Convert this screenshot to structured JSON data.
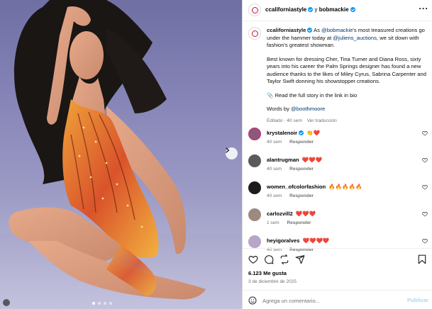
{
  "post": {
    "header_owner": "ccaliforniastyle",
    "header_joiner": "y",
    "header_collaborator": "bobmackie"
  },
  "caption": {
    "username": "ccaliforniastyle",
    "lead": "As ",
    "mention_1": "@bobmackie",
    "part_2": "'s most treasured creations go under the hammer today at ",
    "mention_2": "@juliens_auctions",
    "part_3": ", we sit down with fashion's greatest showman.",
    "paragraph_2": "Best known for dressing Cher, Tina Turner and Diana Ross, sixty years into his career the Palm Springs designer has found a new audience thanks to the likes of Miley Cyrus, Sabrina Carpenter and Taylor Swift donning his showstopper creations.",
    "paragraph_3": "📎 Read the full story in the link in bio",
    "words_by": "Words by ",
    "words_by_mention": "@boothmoore",
    "edited": "Editado · 40 sem",
    "see_translation": "Ver traducción"
  },
  "comments": [
    {
      "user": "krystalenoir",
      "verified": true,
      "text": "👏❤️",
      "time": "40 sem",
      "reply": "Responder",
      "avatar_color": "#8a5a7a"
    },
    {
      "user": "alantrugman",
      "verified": false,
      "text": "❤️❤️❤️",
      "time": "40 sem",
      "reply": "Responder",
      "avatar_color": "#5a5a5a"
    },
    {
      "user": "women_ofcolorfashion",
      "verified": false,
      "text": "🔥🔥🔥🔥🔥",
      "time": "40 sem",
      "reply": "Responder",
      "avatar_color": "#1c1c1c"
    },
    {
      "user": "carlozvill2",
      "verified": false,
      "text": "❤️❤️❤️",
      "time": "1 sem",
      "reply": "Responder",
      "avatar_color": "#9c8a80"
    },
    {
      "user": "heyigoralves",
      "verified": false,
      "text": "❤️❤️❤️❤️",
      "time": "40 sem",
      "reply": "Responder",
      "avatar_color": "#b7a6c8"
    }
  ],
  "actions": {
    "like_icon": "heart-icon",
    "comment_icon": "comment-icon",
    "share_icon": "repost-icon",
    "send_icon": "send-icon",
    "save_icon": "bookmark-icon"
  },
  "stats": {
    "likes": "6.123 Me gusta",
    "date": "3 de diciembre de 2025"
  },
  "composer": {
    "placeholder": "Agrega un comentario...",
    "publish": "Publicar"
  },
  "colors": {
    "accent": "#0095f6",
    "link": "#00376b",
    "muted": "#737373",
    "brand_ring": "#c8102e"
  }
}
